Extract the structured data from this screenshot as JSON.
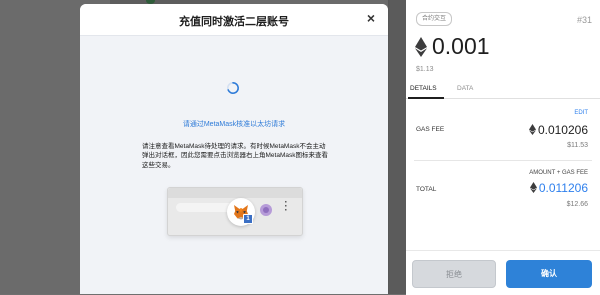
{
  "modal": {
    "title": "充值同时激活二层账号",
    "close_label": "×",
    "link_text": "请通过MetaMask核准以太坊请求",
    "info_text": "请注意查看MetaMask待处理的请求。有时候MetaMask不会主动\n弹出对话框，因此您需要点击浏览器右上角MetaMask图标来查看\n这些交易。",
    "badge_count": "1"
  },
  "panel": {
    "contract_pill": "合约交互",
    "tx_number": "#31",
    "amount": "0.001",
    "amount_usd": "$1.13",
    "tabs": [
      {
        "label": "DETAILS",
        "active": true
      },
      {
        "label": "DATA",
        "active": false
      }
    ],
    "edit_label": "EDIT",
    "gas_fee_label": "GAS FEE",
    "gas_fee_value": "0.010206",
    "gas_fee_usd": "$11.53",
    "amount_gas_label": "AMOUNT + GAS FEE",
    "total_label": "TOTAL",
    "total_value": "0.011206",
    "total_usd": "$12.66",
    "reject_label": "拒绝",
    "confirm_label": "确认"
  },
  "colors": {
    "accent": "#2e82d8",
    "link": "#2f80ed",
    "overlay": "#6b6b6b"
  },
  "icons": {
    "close": "close-icon",
    "spinner": "loading-spinner-icon",
    "fox": "metamask-fox-icon",
    "eth": "ethereum-icon",
    "kebab": "more-vertical-icon"
  }
}
